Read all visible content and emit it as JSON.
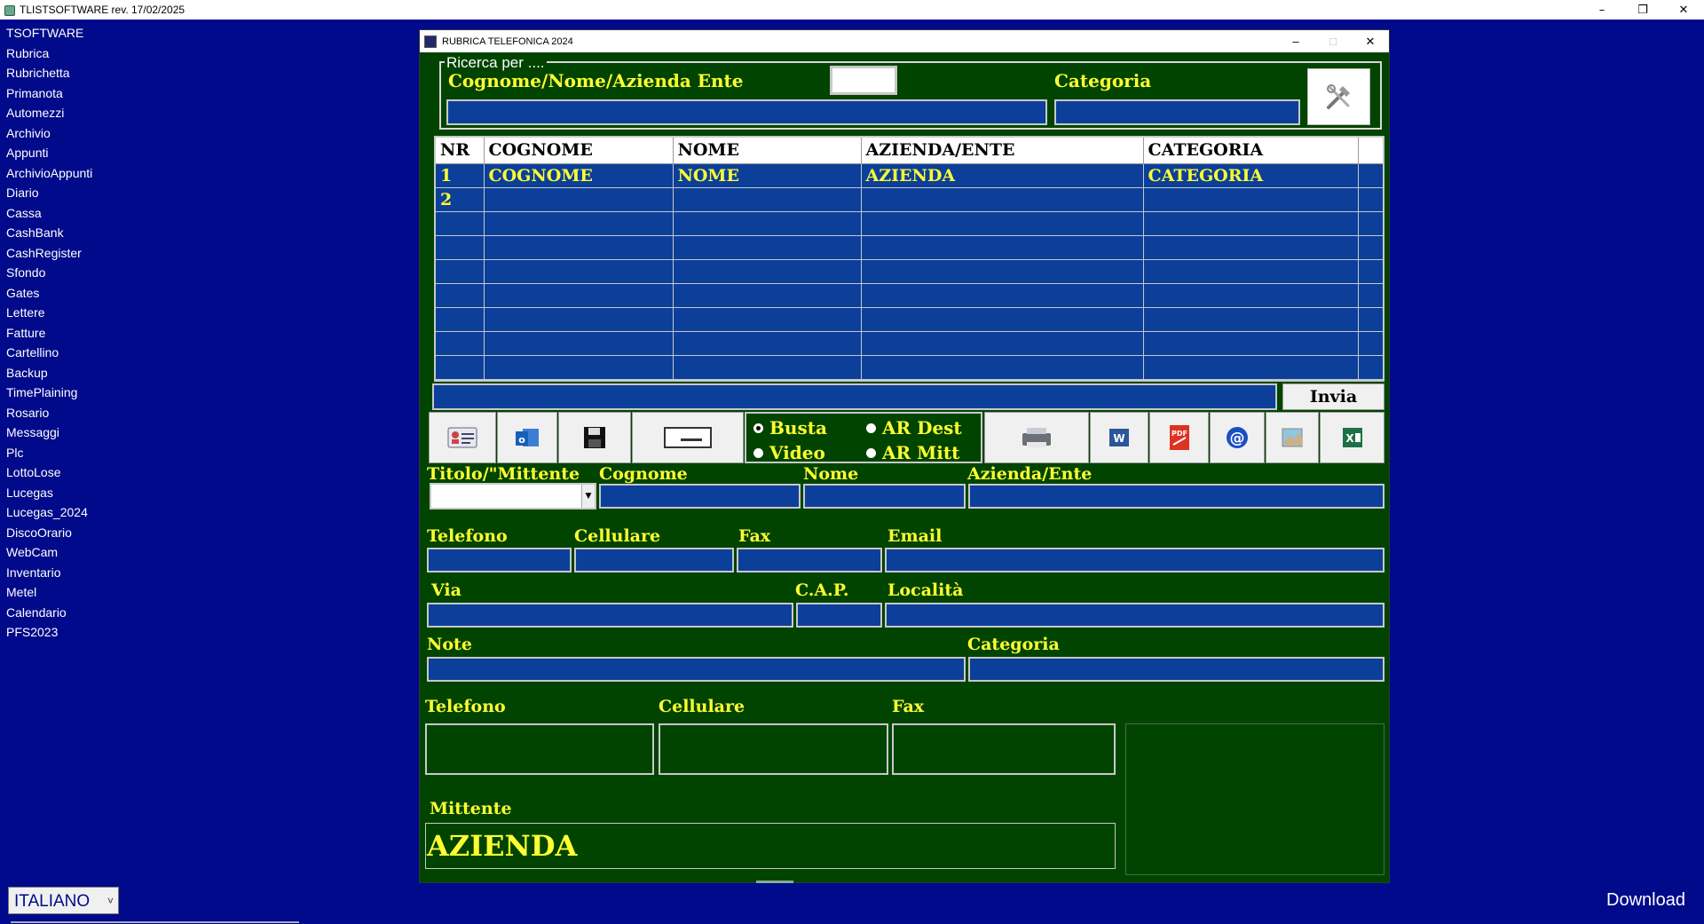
{
  "app": {
    "title": "TLISTSOFTWARE rev. 17/02/2025",
    "minimize": "–",
    "restore": "❐",
    "close": "✕"
  },
  "menu": {
    "items": [
      "TSOFTWARE",
      "Rubrica",
      "Rubrichetta",
      "Primanota",
      "Automezzi",
      "Archivio",
      "Appunti",
      "ArchivioAppunti",
      "Diario",
      "Cassa",
      "CashBank",
      "CashRegister",
      "Sfondo",
      "Gates",
      "Lettere",
      "Fatture",
      "Cartellino",
      "Backup",
      "TimePlaining",
      "Rosario",
      "Messaggi",
      "Plc",
      "LottoLose",
      "Lucegas",
      "Lucegas_2024",
      "DiscoOrario",
      "WebCam",
      "Inventario",
      "Metel",
      "Calendario",
      "PFS2023"
    ]
  },
  "language": {
    "selected": "ITALIANO",
    "arrow": "˅"
  },
  "download": {
    "label": "Download"
  },
  "window": {
    "title": "RUBRICA TELEFONICA 2024",
    "minimize": "–",
    "maximize": "□",
    "close": "✕"
  },
  "search": {
    "legend": "Ricerca per ....",
    "label_main": "Cognome/Nome/Azienda Ente",
    "label_category": "Categoria"
  },
  "grid": {
    "columns": [
      "NR",
      "COGNOME",
      "NOME",
      "AZIENDA/ENTE",
      "CATEGORIA"
    ],
    "rows": [
      [
        "1",
        "COGNOME",
        "NOME",
        "AZIENDA",
        "CATEGORIA"
      ],
      [
        "2",
        "",
        "",
        "",
        ""
      ]
    ]
  },
  "send": {
    "label": "Invia"
  },
  "radios": {
    "busta": "Busta",
    "video": "Video",
    "ar_dest": "AR Dest",
    "ar_mitt": "AR Mitt"
  },
  "form": {
    "titolo": "Titolo/\"Mittente",
    "cognome": "Cognome",
    "nome": "Nome",
    "azienda": "Azienda/Ente",
    "telefono": "Telefono",
    "cellulare": "Cellulare",
    "fax": "Fax",
    "email": "Email",
    "via": "Via",
    "cap": "C.A.P.",
    "localita": "Località",
    "note": "Note",
    "categoria": "Categoria",
    "telefono2": "Telefono",
    "cellulare2": "Cellulare",
    "fax2": "Fax",
    "mittente": "Mittente",
    "mittente_value": "AZIENDA"
  },
  "colors": {
    "background": "#000a8a",
    "panel": "#004400",
    "field": "#0c3f99",
    "label": "#ffff33"
  }
}
